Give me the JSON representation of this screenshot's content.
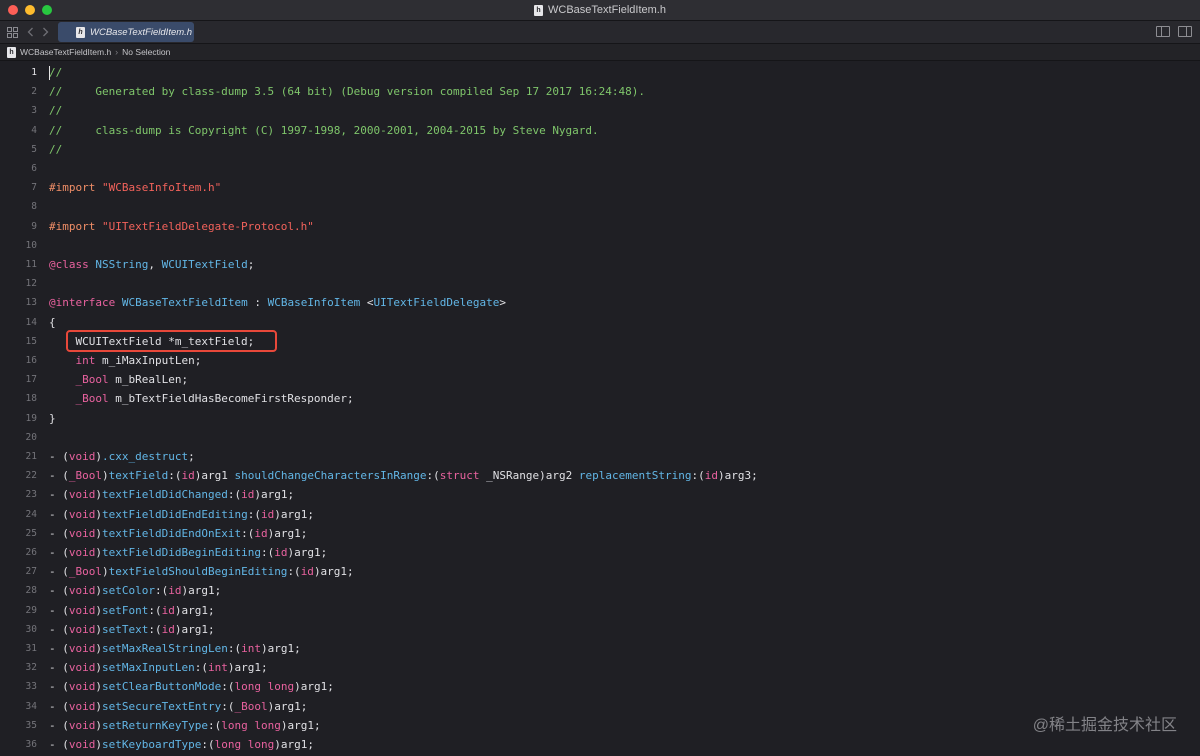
{
  "window": {
    "title": "WCBaseTextFieldItem.h"
  },
  "tab": {
    "label": "WCBaseTextFieldItem.h"
  },
  "jumpbar": {
    "file": "WCBaseTextFieldItem.h",
    "selection": "No Selection"
  },
  "icons": {
    "file": "header-file-icon",
    "grid": "grid-icon",
    "back": "chevron-left-icon",
    "forward": "chevron-right-icon",
    "editor_options": "editor-options-icon",
    "inspector": "inspector-icon"
  },
  "colors": {
    "comment": "#7fc66b",
    "preprocessor": "#f08e67",
    "string": "#f2625b",
    "keyword": "#e9629f",
    "type": "#62b6e6",
    "highlight_box": "#e8483a"
  },
  "current_line": 1,
  "highlighted_line": 15,
  "code_lines": [
    [
      [
        "c",
        "//"
      ]
    ],
    [
      [
        "c",
        "//     Generated by class-dump 3.5 (64 bit) (Debug version compiled Sep 17 2017 16:24:48)."
      ]
    ],
    [
      [
        "c",
        "//"
      ]
    ],
    [
      [
        "c",
        "//     class-dump is Copyright (C) 1997-1998, 2000-2001, 2004-2015 by Steve Nygard."
      ]
    ],
    [
      [
        "c",
        "//"
      ]
    ],
    [],
    [
      [
        "pp",
        "#import "
      ],
      [
        "s",
        "\"WCBaseInfoItem.h\""
      ]
    ],
    [],
    [
      [
        "pp",
        "#import "
      ],
      [
        "s",
        "\"UITextFieldDelegate-Protocol.h\""
      ]
    ],
    [],
    [
      [
        "k",
        "@class"
      ],
      [
        "p",
        " "
      ],
      [
        "t",
        "NSString"
      ],
      [
        "p",
        ", "
      ],
      [
        "t",
        "WCUITextField"
      ],
      [
        "p",
        ";"
      ]
    ],
    [],
    [
      [
        "k",
        "@interface"
      ],
      [
        "p",
        " "
      ],
      [
        "t",
        "WCBaseTextFieldItem"
      ],
      [
        "p",
        " : "
      ],
      [
        "t",
        "WCBaseInfoItem"
      ],
      [
        "p",
        " <"
      ],
      [
        "t",
        "UITextFieldDelegate"
      ],
      [
        "p",
        ">"
      ]
    ],
    [
      [
        "p",
        "{"
      ]
    ],
    [
      [
        "p",
        "    WCUITextField *m_textField;"
      ]
    ],
    [
      [
        "p",
        "    "
      ],
      [
        "k",
        "int"
      ],
      [
        "p",
        " m_iMaxInputLen;"
      ]
    ],
    [
      [
        "p",
        "    "
      ],
      [
        "k",
        "_Bool"
      ],
      [
        "p",
        " m_bRealLen;"
      ]
    ],
    [
      [
        "p",
        "    "
      ],
      [
        "k",
        "_Bool"
      ],
      [
        "p",
        " m_bTextFieldHasBecomeFirstResponder;"
      ]
    ],
    [
      [
        "p",
        "}"
      ]
    ],
    [],
    [
      [
        "p",
        "- ("
      ],
      [
        "k",
        "void"
      ],
      [
        "p",
        ")"
      ],
      [
        "t",
        ".cxx_destruct"
      ],
      [
        "p",
        ";"
      ]
    ],
    [
      [
        "p",
        "- ("
      ],
      [
        "k",
        "_Bool"
      ],
      [
        "p",
        ")"
      ],
      [
        "t",
        "textField"
      ],
      [
        "p",
        ":("
      ],
      [
        "k",
        "id"
      ],
      [
        "p",
        ")arg1 "
      ],
      [
        "t",
        "shouldChangeCharactersInRange"
      ],
      [
        "p",
        ":("
      ],
      [
        "k",
        "struct"
      ],
      [
        "p",
        " _NSRange)arg2 "
      ],
      [
        "t",
        "replacementString"
      ],
      [
        "p",
        ":("
      ],
      [
        "k",
        "id"
      ],
      [
        "p",
        ")arg3;"
      ]
    ],
    [
      [
        "p",
        "- ("
      ],
      [
        "k",
        "void"
      ],
      [
        "p",
        ")"
      ],
      [
        "t",
        "textFieldDidChanged"
      ],
      [
        "p",
        ":("
      ],
      [
        "k",
        "id"
      ],
      [
        "p",
        ")arg1;"
      ]
    ],
    [
      [
        "p",
        "- ("
      ],
      [
        "k",
        "void"
      ],
      [
        "p",
        ")"
      ],
      [
        "t",
        "textFieldDidEndEditing"
      ],
      [
        "p",
        ":("
      ],
      [
        "k",
        "id"
      ],
      [
        "p",
        ")arg1;"
      ]
    ],
    [
      [
        "p",
        "- ("
      ],
      [
        "k",
        "void"
      ],
      [
        "p",
        ")"
      ],
      [
        "t",
        "textFieldDidEndOnExit"
      ],
      [
        "p",
        ":("
      ],
      [
        "k",
        "id"
      ],
      [
        "p",
        ")arg1;"
      ]
    ],
    [
      [
        "p",
        "- ("
      ],
      [
        "k",
        "void"
      ],
      [
        "p",
        ")"
      ],
      [
        "t",
        "textFieldDidBeginEditing"
      ],
      [
        "p",
        ":("
      ],
      [
        "k",
        "id"
      ],
      [
        "p",
        ")arg1;"
      ]
    ],
    [
      [
        "p",
        "- ("
      ],
      [
        "k",
        "_Bool"
      ],
      [
        "p",
        ")"
      ],
      [
        "t",
        "textFieldShouldBeginEditing"
      ],
      [
        "p",
        ":("
      ],
      [
        "k",
        "id"
      ],
      [
        "p",
        ")arg1;"
      ]
    ],
    [
      [
        "p",
        "- ("
      ],
      [
        "k",
        "void"
      ],
      [
        "p",
        ")"
      ],
      [
        "t",
        "setColor"
      ],
      [
        "p",
        ":("
      ],
      [
        "k",
        "id"
      ],
      [
        "p",
        ")arg1;"
      ]
    ],
    [
      [
        "p",
        "- ("
      ],
      [
        "k",
        "void"
      ],
      [
        "p",
        ")"
      ],
      [
        "t",
        "setFont"
      ],
      [
        "p",
        ":("
      ],
      [
        "k",
        "id"
      ],
      [
        "p",
        ")arg1;"
      ]
    ],
    [
      [
        "p",
        "- ("
      ],
      [
        "k",
        "void"
      ],
      [
        "p",
        ")"
      ],
      [
        "t",
        "setText"
      ],
      [
        "p",
        ":("
      ],
      [
        "k",
        "id"
      ],
      [
        "p",
        ")arg1;"
      ]
    ],
    [
      [
        "p",
        "- ("
      ],
      [
        "k",
        "void"
      ],
      [
        "p",
        ")"
      ],
      [
        "t",
        "setMaxRealStringLen"
      ],
      [
        "p",
        ":("
      ],
      [
        "k",
        "int"
      ],
      [
        "p",
        ")arg1;"
      ]
    ],
    [
      [
        "p",
        "- ("
      ],
      [
        "k",
        "void"
      ],
      [
        "p",
        ")"
      ],
      [
        "t",
        "setMaxInputLen"
      ],
      [
        "p",
        ":("
      ],
      [
        "k",
        "int"
      ],
      [
        "p",
        ")arg1;"
      ]
    ],
    [
      [
        "p",
        "- ("
      ],
      [
        "k",
        "void"
      ],
      [
        "p",
        ")"
      ],
      [
        "t",
        "setClearButtonMode"
      ],
      [
        "p",
        ":("
      ],
      [
        "k",
        "long long"
      ],
      [
        "p",
        ")arg1;"
      ]
    ],
    [
      [
        "p",
        "- ("
      ],
      [
        "k",
        "void"
      ],
      [
        "p",
        ")"
      ],
      [
        "t",
        "setSecureTextEntry"
      ],
      [
        "p",
        ":("
      ],
      [
        "k",
        "_Bool"
      ],
      [
        "p",
        ")arg1;"
      ]
    ],
    [
      [
        "p",
        "- ("
      ],
      [
        "k",
        "void"
      ],
      [
        "p",
        ")"
      ],
      [
        "t",
        "setReturnKeyType"
      ],
      [
        "p",
        ":("
      ],
      [
        "k",
        "long long"
      ],
      [
        "p",
        ")arg1;"
      ]
    ],
    [
      [
        "p",
        "- ("
      ],
      [
        "k",
        "void"
      ],
      [
        "p",
        ")"
      ],
      [
        "t",
        "setKeyboardType"
      ],
      [
        "p",
        ":("
      ],
      [
        "k",
        "long long"
      ],
      [
        "p",
        ")arg1;"
      ]
    ]
  ],
  "watermark": "@稀土掘金技术社区"
}
